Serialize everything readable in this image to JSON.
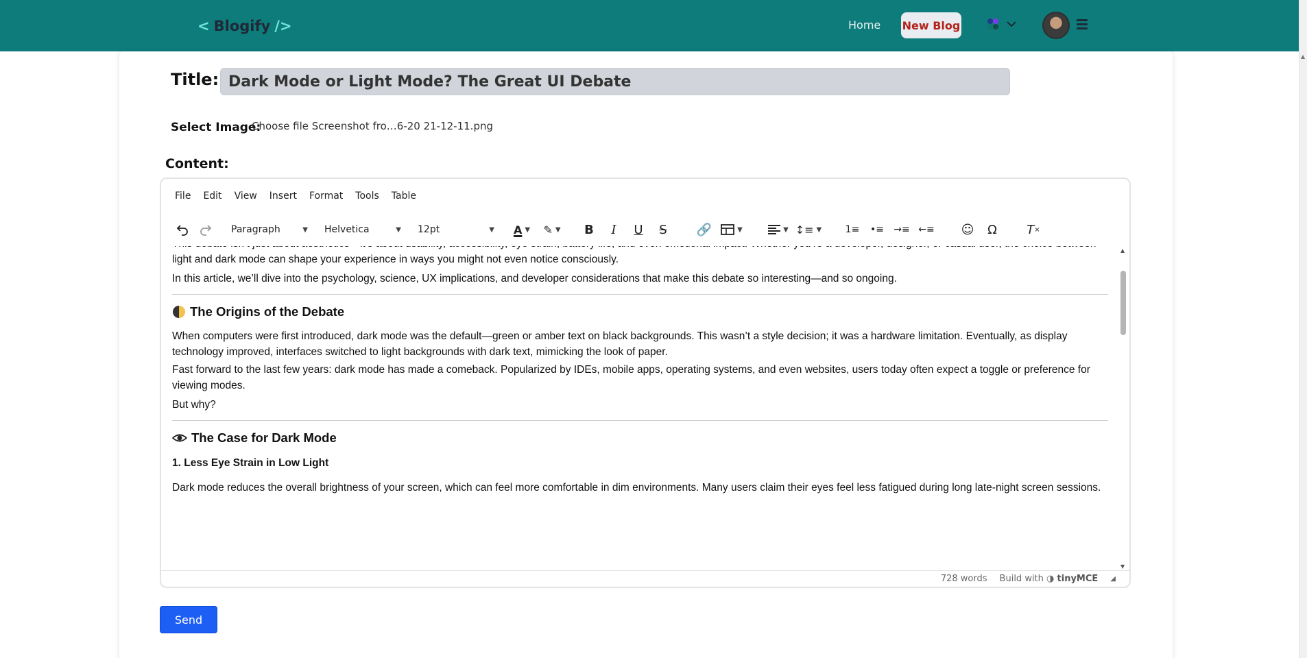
{
  "header": {
    "logo_open": "<",
    "logo_text": "Blogify",
    "logo_close": "/>",
    "nav_home": "Home",
    "nav_new_blog": "New Blog"
  },
  "form": {
    "title_label": "Title:",
    "title_value": "Dark Mode or Light Mode? The Great UI Debate",
    "image_label": "Select Image:",
    "file_text": "Choose file Screenshot fro…6-20 21-12-11.png",
    "content_label": "Content:",
    "send_label": "Send"
  },
  "editor": {
    "menu": [
      "File",
      "Edit",
      "View",
      "Insert",
      "Format",
      "Tools",
      "Table"
    ],
    "block_format": "Paragraph",
    "font_family": "Helvetica",
    "font_size": "12pt",
    "status_words": "728 words",
    "status_build": "Build with",
    "status_brand": "tinyMCE",
    "content": {
      "p_cut": "This debate isn’t just about aesthetics—it’s about usability, accessibility, eye strain, battery life, and even emotional impact. Whether you’re a developer, designer, or casual user, the choice between light and dark mode can shape your experience in ways you might not even notice consciously.",
      "p_intro": "In this article, we’ll dive into the psychology, science, UX implications, and developer considerations that make this debate so interesting—and so ongoing.",
      "h_origins": "The Origins of the Debate",
      "p_origins1": "When computers were first introduced, dark mode was the default—green or amber text on black backgrounds. This wasn’t a style decision; it was a hardware limitation. Eventually, as display technology improved, interfaces switched to light backgrounds with dark text, mimicking the look of paper.",
      "p_origins2": "Fast forward to the last few years: dark mode has made a comeback. Popularized by IDEs, mobile apps, operating systems, and even websites, users today often expect a toggle or preference for viewing modes.",
      "p_why": "But why?",
      "h_case": "The Case for Dark Mode",
      "h3_eye": "1. Less Eye Strain in Low Light",
      "p_eye": "Dark mode reduces the overall brightness of your screen, which can feel more comfortable in dim environments. Many users claim their eyes feel less fatigued during long late-night screen sessions."
    }
  },
  "colors": {
    "header_bg": "#0e7c7b",
    "new_blog_text": "#b4231b",
    "send_bg": "#1d5ff5"
  }
}
